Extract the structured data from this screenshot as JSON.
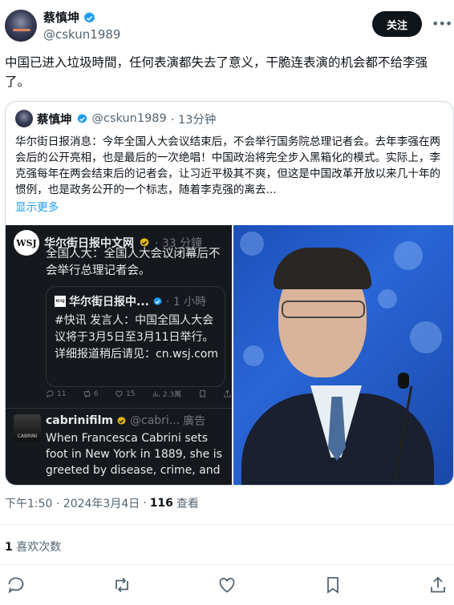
{
  "author": {
    "name": "蔡慎坤",
    "handle": "@cskun1989",
    "follow_label": "关注"
  },
  "tweet": {
    "text": "中国已进入垃圾時間，任何表演都失去了意义，干脆连表演的机会都不给李强了。"
  },
  "quoted": {
    "name": "蔡慎坤",
    "handle": "@cskun1989",
    "time": "· 13分钟",
    "text": "华尔街日报消息：今年全国人大会议结束后，不会举行国务院总理记者会。去年李强在两会后的公开亮相，也是最后的一次绝唱！中国政治将完全步入黑箱化的模式。实际上，李克强每年在两会结束后的记者会，让习近平极其不爽，但这是中国改革开放以来几十年的惯例，也是政务公开的一个标志，随着李克强的离去...",
    "show_more": "显示更多"
  },
  "embedded": {
    "name": "华尔街日报中文网",
    "time": "· 33 分鐘",
    "logo_text": "WSJ",
    "text": "全国人大：全国人大会议闭幕后不会举行总理记者会。",
    "inner_name": "华尔街日报中...",
    "inner_time": "· 1 小時",
    "inner_logo_text": "WSJ",
    "inner_text": "#快讯 发言人：中国全国人大会议将于3月5日至3月11日举行。详细报道稍后请见：cn.wsj.com",
    "actions": {
      "reply": "11",
      "retweet": "6",
      "like": "15",
      "views": "2.3萬"
    },
    "ad_name": "cabrinifilm",
    "ad_handle": "@cabri...",
    "ad_label": "廣告",
    "ad_avatar_text": "CABRINI",
    "ad_text": "When Francesca Cabrini sets foot in New York in 1889, she is greeted by disease, crime, and"
  },
  "meta": {
    "time": "下午1:50 · 2024年3月4日",
    "views_count": "116",
    "views_label": "查看",
    "likes_count": "1",
    "likes_label": "喜欢次数"
  },
  "colors": {
    "accent": "#1d9bf0",
    "text": "#0f1419",
    "muted": "#536471"
  }
}
